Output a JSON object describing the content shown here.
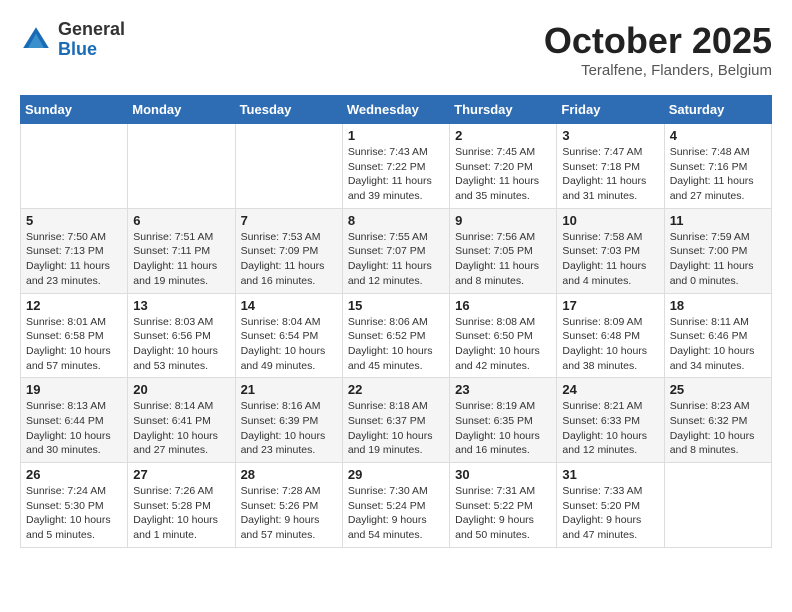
{
  "header": {
    "logo_general": "General",
    "logo_blue": "Blue",
    "title": "October 2025",
    "subtitle": "Teralfene, Flanders, Belgium"
  },
  "days_of_week": [
    "Sunday",
    "Monday",
    "Tuesday",
    "Wednesday",
    "Thursday",
    "Friday",
    "Saturday"
  ],
  "weeks": [
    [
      {
        "day": "",
        "info": ""
      },
      {
        "day": "",
        "info": ""
      },
      {
        "day": "",
        "info": ""
      },
      {
        "day": "1",
        "info": "Sunrise: 7:43 AM\nSunset: 7:22 PM\nDaylight: 11 hours and 39 minutes."
      },
      {
        "day": "2",
        "info": "Sunrise: 7:45 AM\nSunset: 7:20 PM\nDaylight: 11 hours and 35 minutes."
      },
      {
        "day": "3",
        "info": "Sunrise: 7:47 AM\nSunset: 7:18 PM\nDaylight: 11 hours and 31 minutes."
      },
      {
        "day": "4",
        "info": "Sunrise: 7:48 AM\nSunset: 7:16 PM\nDaylight: 11 hours and 27 minutes."
      }
    ],
    [
      {
        "day": "5",
        "info": "Sunrise: 7:50 AM\nSunset: 7:13 PM\nDaylight: 11 hours and 23 minutes."
      },
      {
        "day": "6",
        "info": "Sunrise: 7:51 AM\nSunset: 7:11 PM\nDaylight: 11 hours and 19 minutes."
      },
      {
        "day": "7",
        "info": "Sunrise: 7:53 AM\nSunset: 7:09 PM\nDaylight: 11 hours and 16 minutes."
      },
      {
        "day": "8",
        "info": "Sunrise: 7:55 AM\nSunset: 7:07 PM\nDaylight: 11 hours and 12 minutes."
      },
      {
        "day": "9",
        "info": "Sunrise: 7:56 AM\nSunset: 7:05 PM\nDaylight: 11 hours and 8 minutes."
      },
      {
        "day": "10",
        "info": "Sunrise: 7:58 AM\nSunset: 7:03 PM\nDaylight: 11 hours and 4 minutes."
      },
      {
        "day": "11",
        "info": "Sunrise: 7:59 AM\nSunset: 7:00 PM\nDaylight: 11 hours and 0 minutes."
      }
    ],
    [
      {
        "day": "12",
        "info": "Sunrise: 8:01 AM\nSunset: 6:58 PM\nDaylight: 10 hours and 57 minutes."
      },
      {
        "day": "13",
        "info": "Sunrise: 8:03 AM\nSunset: 6:56 PM\nDaylight: 10 hours and 53 minutes."
      },
      {
        "day": "14",
        "info": "Sunrise: 8:04 AM\nSunset: 6:54 PM\nDaylight: 10 hours and 49 minutes."
      },
      {
        "day": "15",
        "info": "Sunrise: 8:06 AM\nSunset: 6:52 PM\nDaylight: 10 hours and 45 minutes."
      },
      {
        "day": "16",
        "info": "Sunrise: 8:08 AM\nSunset: 6:50 PM\nDaylight: 10 hours and 42 minutes."
      },
      {
        "day": "17",
        "info": "Sunrise: 8:09 AM\nSunset: 6:48 PM\nDaylight: 10 hours and 38 minutes."
      },
      {
        "day": "18",
        "info": "Sunrise: 8:11 AM\nSunset: 6:46 PM\nDaylight: 10 hours and 34 minutes."
      }
    ],
    [
      {
        "day": "19",
        "info": "Sunrise: 8:13 AM\nSunset: 6:44 PM\nDaylight: 10 hours and 30 minutes."
      },
      {
        "day": "20",
        "info": "Sunrise: 8:14 AM\nSunset: 6:41 PM\nDaylight: 10 hours and 27 minutes."
      },
      {
        "day": "21",
        "info": "Sunrise: 8:16 AM\nSunset: 6:39 PM\nDaylight: 10 hours and 23 minutes."
      },
      {
        "day": "22",
        "info": "Sunrise: 8:18 AM\nSunset: 6:37 PM\nDaylight: 10 hours and 19 minutes."
      },
      {
        "day": "23",
        "info": "Sunrise: 8:19 AM\nSunset: 6:35 PM\nDaylight: 10 hours and 16 minutes."
      },
      {
        "day": "24",
        "info": "Sunrise: 8:21 AM\nSunset: 6:33 PM\nDaylight: 10 hours and 12 minutes."
      },
      {
        "day": "25",
        "info": "Sunrise: 8:23 AM\nSunset: 6:32 PM\nDaylight: 10 hours and 8 minutes."
      }
    ],
    [
      {
        "day": "26",
        "info": "Sunrise: 7:24 AM\nSunset: 5:30 PM\nDaylight: 10 hours and 5 minutes."
      },
      {
        "day": "27",
        "info": "Sunrise: 7:26 AM\nSunset: 5:28 PM\nDaylight: 10 hours and 1 minute."
      },
      {
        "day": "28",
        "info": "Sunrise: 7:28 AM\nSunset: 5:26 PM\nDaylight: 9 hours and 57 minutes."
      },
      {
        "day": "29",
        "info": "Sunrise: 7:30 AM\nSunset: 5:24 PM\nDaylight: 9 hours and 54 minutes."
      },
      {
        "day": "30",
        "info": "Sunrise: 7:31 AM\nSunset: 5:22 PM\nDaylight: 9 hours and 50 minutes."
      },
      {
        "day": "31",
        "info": "Sunrise: 7:33 AM\nSunset: 5:20 PM\nDaylight: 9 hours and 47 minutes."
      },
      {
        "day": "",
        "info": ""
      }
    ]
  ]
}
